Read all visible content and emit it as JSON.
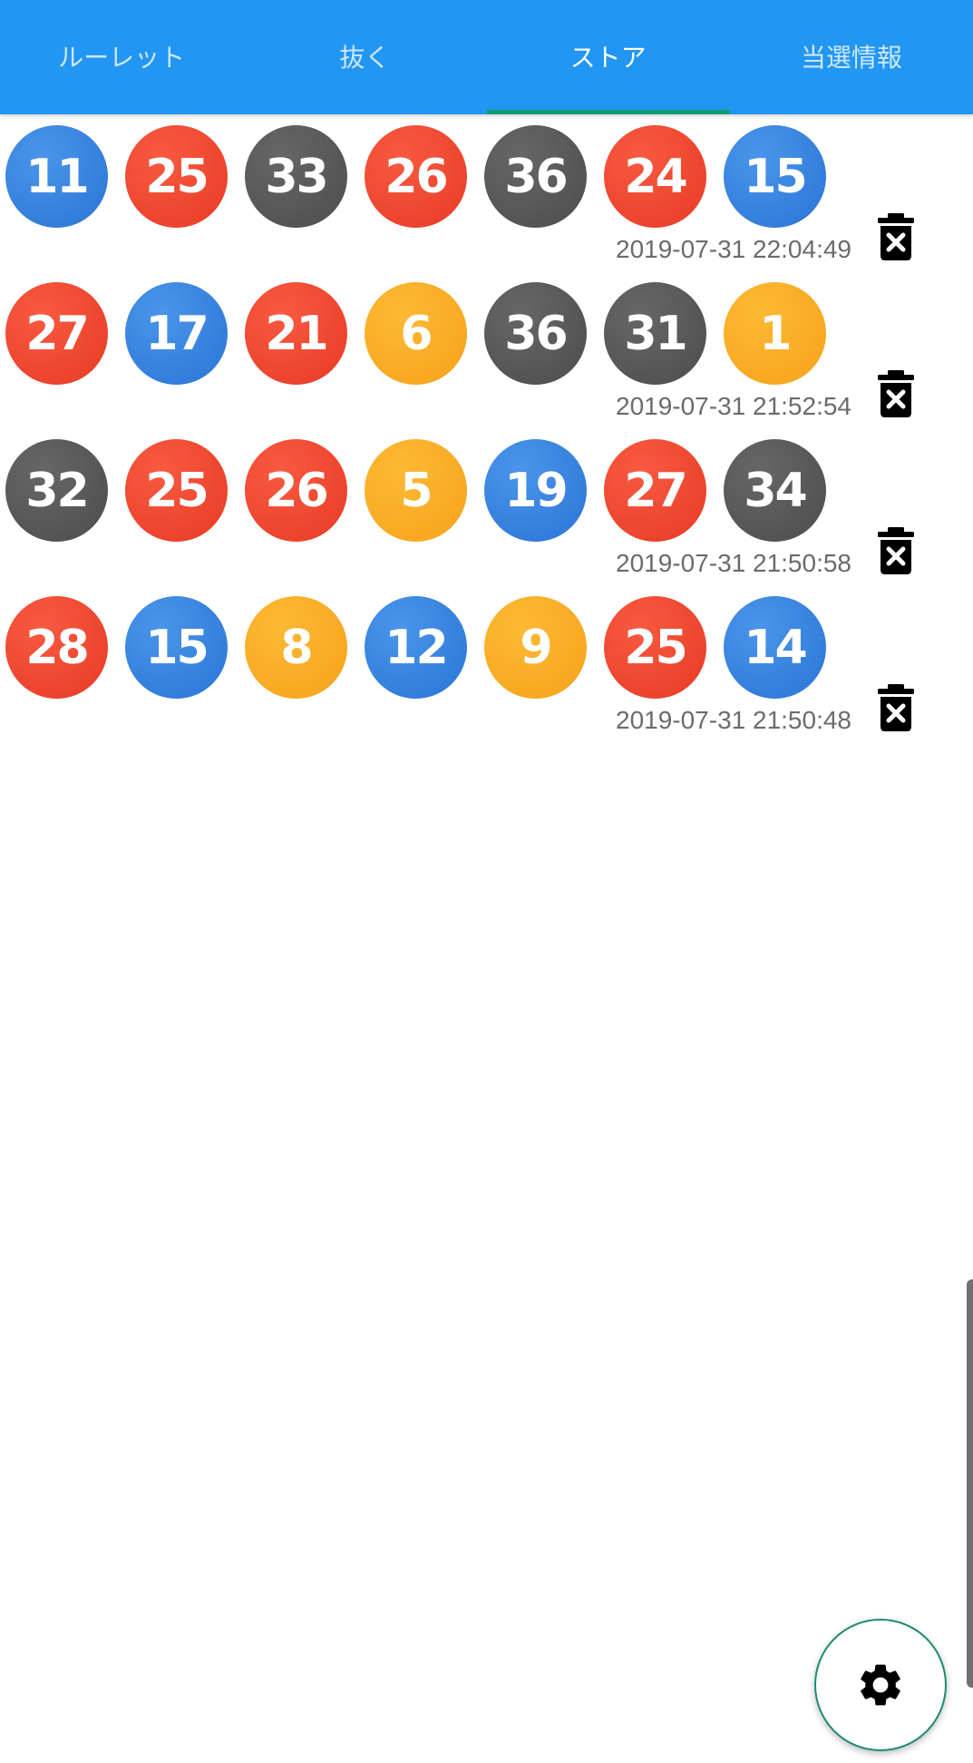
{
  "tabs": [
    {
      "label": "ルーレット",
      "active": false
    },
    {
      "label": "抜く",
      "active": false
    },
    {
      "label": "ストア",
      "active": true
    },
    {
      "label": "当選情報",
      "active": false
    }
  ],
  "colors": {
    "appbar": "#2196F3",
    "tab_indicator": "#0f9d76",
    "ball_blue": "#2a74d6",
    "ball_red": "#e93a24",
    "ball_gray": "#4d4d4d",
    "ball_yellow": "#f6a21b"
  },
  "entries": [
    {
      "timestamp": "2019-07-31 22:04:49",
      "balls": [
        {
          "number": "11",
          "color": "blue"
        },
        {
          "number": "25",
          "color": "red"
        },
        {
          "number": "33",
          "color": "gray"
        },
        {
          "number": "26",
          "color": "red"
        },
        {
          "number": "36",
          "color": "gray"
        },
        {
          "number": "24",
          "color": "red"
        },
        {
          "number": "15",
          "color": "blue"
        }
      ],
      "delete_icon": "delete-forever-icon"
    },
    {
      "timestamp": "2019-07-31 21:52:54",
      "balls": [
        {
          "number": "27",
          "color": "red"
        },
        {
          "number": "17",
          "color": "blue"
        },
        {
          "number": "21",
          "color": "red"
        },
        {
          "number": "6",
          "color": "yellow"
        },
        {
          "number": "36",
          "color": "gray"
        },
        {
          "number": "31",
          "color": "gray"
        },
        {
          "number": "1",
          "color": "yellow"
        }
      ],
      "delete_icon": "delete-forever-icon"
    },
    {
      "timestamp": "2019-07-31 21:50:58",
      "balls": [
        {
          "number": "32",
          "color": "gray"
        },
        {
          "number": "25",
          "color": "red"
        },
        {
          "number": "26",
          "color": "red"
        },
        {
          "number": "5",
          "color": "yellow"
        },
        {
          "number": "19",
          "color": "blue"
        },
        {
          "number": "27",
          "color": "red"
        },
        {
          "number": "34",
          "color": "gray"
        }
      ],
      "delete_icon": "delete-forever-icon"
    },
    {
      "timestamp": "2019-07-31 21:50:48",
      "balls": [
        {
          "number": "28",
          "color": "red"
        },
        {
          "number": "15",
          "color": "blue"
        },
        {
          "number": "8",
          "color": "yellow"
        },
        {
          "number": "12",
          "color": "blue"
        },
        {
          "number": "9",
          "color": "yellow"
        },
        {
          "number": "25",
          "color": "red"
        },
        {
          "number": "14",
          "color": "blue"
        }
      ],
      "delete_icon": "delete-forever-icon"
    }
  ],
  "fab": {
    "icon": "gear-icon"
  }
}
